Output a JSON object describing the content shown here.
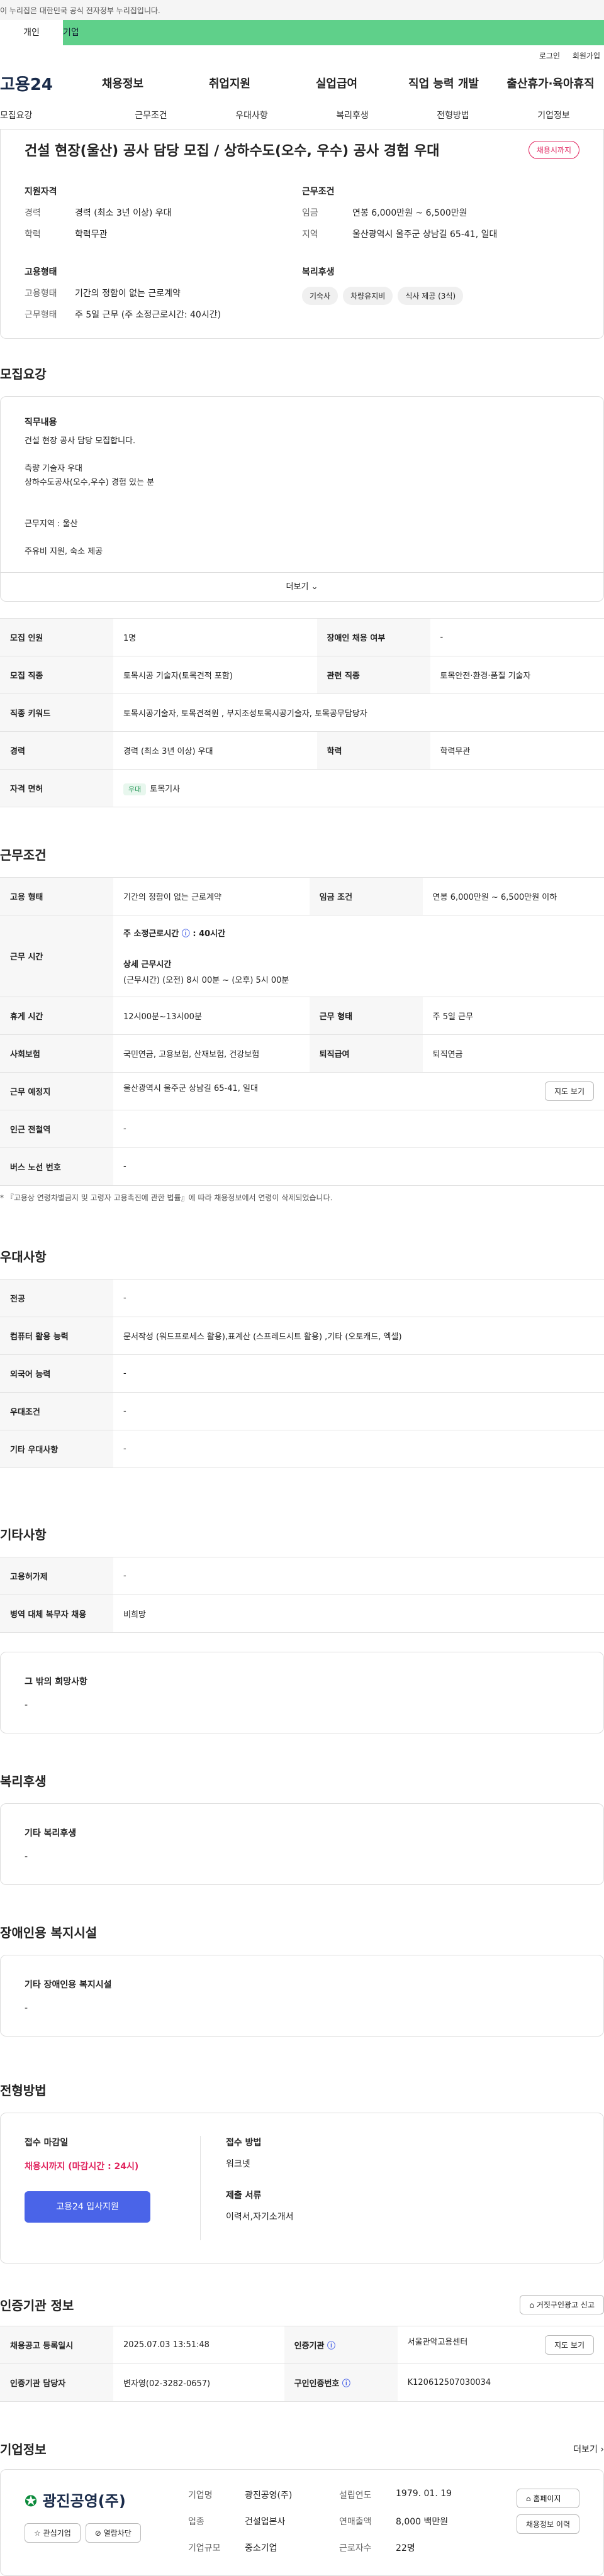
{
  "gov_notice": "이 누리집은 대한민국 공식 전자정부 누리집입니다.",
  "top_tabs": [
    "개인",
    "기업"
  ],
  "util": [
    "로그인",
    "회원가입"
  ],
  "logo": "고용24",
  "gnb": [
    "채용정보",
    "취업지원",
    "실업급여",
    "직업 능력 개발",
    "출산휴가·육아휴직"
  ],
  "subnav": [
    "모집요강",
    "근무조건",
    "우대사항",
    "복리후생",
    "전형방법",
    "기업정보"
  ],
  "title": "건설 현장(울산) 공사 담당 모집 / 상하수도(오수, 우수) 공사 경험 우대",
  "status": "채용시까지",
  "sum": {
    "qual_h": "지원자격",
    "cond_h": "근무조건",
    "emp_h": "고용형태",
    "wel_h": "복리후생",
    "career_k": "경력",
    "career_v": "경력 (최소 3년 이상) 우대",
    "edu_k": "학력",
    "edu_v": "학력무관",
    "wage_k": "임금",
    "wage_v": "연봉 6,000만원 ~ 6,500만원",
    "area_k": "지역",
    "area_v": "울산광역시 울주군 상남길 65-41, 일대",
    "etype_k": "고용형태",
    "etype_v": "기간의 정함이 없는 근로계약",
    "wtype_k": "근무형태",
    "wtype_v": "주 5일 근무 (주 소정근로시간: 40시간)",
    "chips": [
      "기숙사",
      "차량유지비",
      "식사 제공 (3식)"
    ]
  },
  "recruit": {
    "h": "모집요강",
    "desc_h": "직무내용",
    "desc": [
      "건설 현장 공사 담당 모집합니다.",
      "측량 기술자 우대",
      "상하수도공사(오수,우수) 경험 있는 분",
      "근무지역 : 울산",
      "주유비 지원, 숙소 제공"
    ],
    "more": "더보기",
    "rows": [
      [
        "모집 인원",
        "1명",
        "장애인 채용 여부",
        "-"
      ],
      [
        "모집 직종",
        "토목시공 기술자(토목견적 포함)",
        "관련 직종",
        "토목안전·환경·품질 기술자"
      ],
      [
        "직종 키워드",
        "토목시공기술자, 토목견적원 , 부지조성토목시공기술자, 토목공무담당자",
        "",
        ""
      ],
      [
        "경력",
        "경력 (최소 3년 이상) 우대",
        "학력",
        "학력무관"
      ],
      [
        "자격 면허",
        "토목기사",
        "",
        ""
      ]
    ],
    "lic_tag": "우대"
  },
  "cond": {
    "h": "근무조건",
    "rows_a": [
      [
        "고용 형태",
        "기간의 정함이 없는 근로계약",
        "임금 조건",
        "연봉 6,000만원 ~ 6,500만원 이하"
      ]
    ],
    "time_k": "근무 시간",
    "time_a": "주 소정근로시간",
    "time_b": "40시간",
    "time_c": "상세 근무시간",
    "time_d": "(근무시간) (오전) 8시 00분 ~ (오후) 5시 00분",
    "rows_b": [
      [
        "휴게 시간",
        "12시00분~13시00분",
        "근무 형태",
        "주 5일 근무"
      ],
      [
        "사회보험",
        "국민연금, 고용보험, 산재보험, 건강보험",
        "퇴직급여",
        "퇴직연금"
      ]
    ],
    "place_k": "근무 예정지",
    "place_v": "울산광역시 울주군 상남길 65-41, 일대",
    "map": "지도 보기",
    "rows_c": [
      [
        "인근 전철역",
        "-"
      ],
      [
        "버스 노선 번호",
        "-"
      ]
    ],
    "note": "* 『고용상 연령차별금지 및 고령자 고용촉진에 관한 법률』에 따라 채용정보에서 연령이 삭제되었습니다."
  },
  "pref": {
    "h": "우대사항",
    "rows": [
      [
        "전공",
        "-"
      ],
      [
        "컴퓨터 활용 능력",
        "문서작성 (워드프로세스 활용),표계산 (스프레드시트 활용) ,기타 (오토캐드, 엑셀)"
      ],
      [
        "외국어 능력",
        "-"
      ],
      [
        "우대조건",
        "-"
      ],
      [
        "기타 우대사항",
        "-"
      ]
    ]
  },
  "etc": {
    "h": "기타사항",
    "rows": [
      [
        "고용허가제",
        "-"
      ],
      [
        "병역 대체 복무자 채용",
        "비희망"
      ]
    ],
    "box_k": "그 밖의 희망사항",
    "box_v": "-"
  },
  "wel": {
    "h": "복리후생",
    "k": "기타 복리후생",
    "v": "-"
  },
  "dis": {
    "h": "장애인용 복지시설",
    "k": "기타 장애인용 복지시설",
    "v": "-"
  },
  "proc": {
    "h": "전형방법",
    "dl_h": "접수 마감일",
    "dl_v": "채용시까지 (마감시간 : 24시)",
    "btn": "고용24 입사지원",
    "m_h": "접수 방법",
    "m_v": "워크넷",
    "d_h": "제출 서류",
    "d_v": "이력서,자기소개서"
  },
  "cert": {
    "h": "인증기관 정보",
    "report": "거짓구인광고 신고",
    "rows": [
      [
        "채용공고 등록일시",
        "2025.07.03 13:51:48",
        "인증기관",
        "서울관악고용센터"
      ],
      [
        "인증기관 담당자",
        "변자영(02-3282-0657)",
        "구인인증번호",
        "K120612507030034"
      ]
    ],
    "map": "지도 보기"
  },
  "comp": {
    "h": "기업정보",
    "more": "더보기",
    "name": "광진공영(주)",
    "fields": [
      [
        "기업명",
        "광진공영(주)",
        "설립연도",
        "1979. 01. 19"
      ],
      [
        "업종",
        "건설업본사",
        "연매출액",
        "8,000 백만원"
      ],
      [
        "기업규모",
        "중소기업",
        "근로자수",
        "22명"
      ]
    ],
    "btns": [
      "홈페이지",
      "채용정보 이력"
    ],
    "fav": "관심기업",
    "block": "열람차단"
  }
}
